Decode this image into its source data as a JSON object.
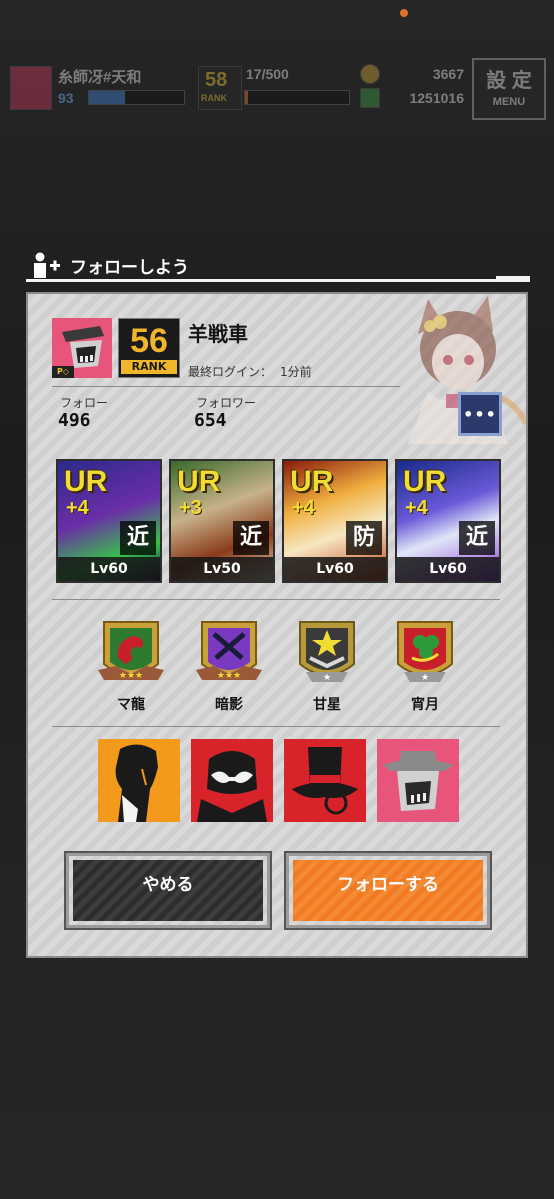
{
  "hud": {
    "player_name": "糸師冴#天和",
    "player_level": "93",
    "level_progress": 0.38,
    "rank_value": "58",
    "rank_word": "RANK",
    "stamina": "17/500",
    "stamina_progress": 0.03,
    "coins": "3667",
    "money": "1251016",
    "settings_label": "設 定",
    "menu_label": "MENU"
  },
  "section": {
    "title": "フォローしよう"
  },
  "profile": {
    "rank_value": "56",
    "rank_word": "RANK",
    "name": "羊戦車",
    "last_login_label": "最終ログイン：",
    "last_login_value": "1分前",
    "follow_label": "フォロー",
    "follow_value": "496",
    "follower_label": "フォロワー",
    "follower_value": "654",
    "more_label": "•••"
  },
  "cards": [
    {
      "rarity": "UR",
      "plus": "+4",
      "role": "近",
      "level": "Lv60"
    },
    {
      "rarity": "UR",
      "plus": "+3",
      "role": "近",
      "level": "Lv50"
    },
    {
      "rarity": "UR",
      "plus": "+4",
      "role": "防",
      "level": "Lv60"
    },
    {
      "rarity": "UR",
      "plus": "+4",
      "role": "近",
      "level": "Lv60"
    }
  ],
  "emblems": [
    {
      "label": "マ龍"
    },
    {
      "label": "暗影"
    },
    {
      "label": "甘星"
    },
    {
      "label": "宵月"
    }
  ],
  "buttons": {
    "cancel": "やめる",
    "follow": "フォローする"
  },
  "colors": {
    "follow_button": "#f07b22",
    "cancel_button": "#3a3a3a",
    "accent_gold": "#f0dc34"
  }
}
